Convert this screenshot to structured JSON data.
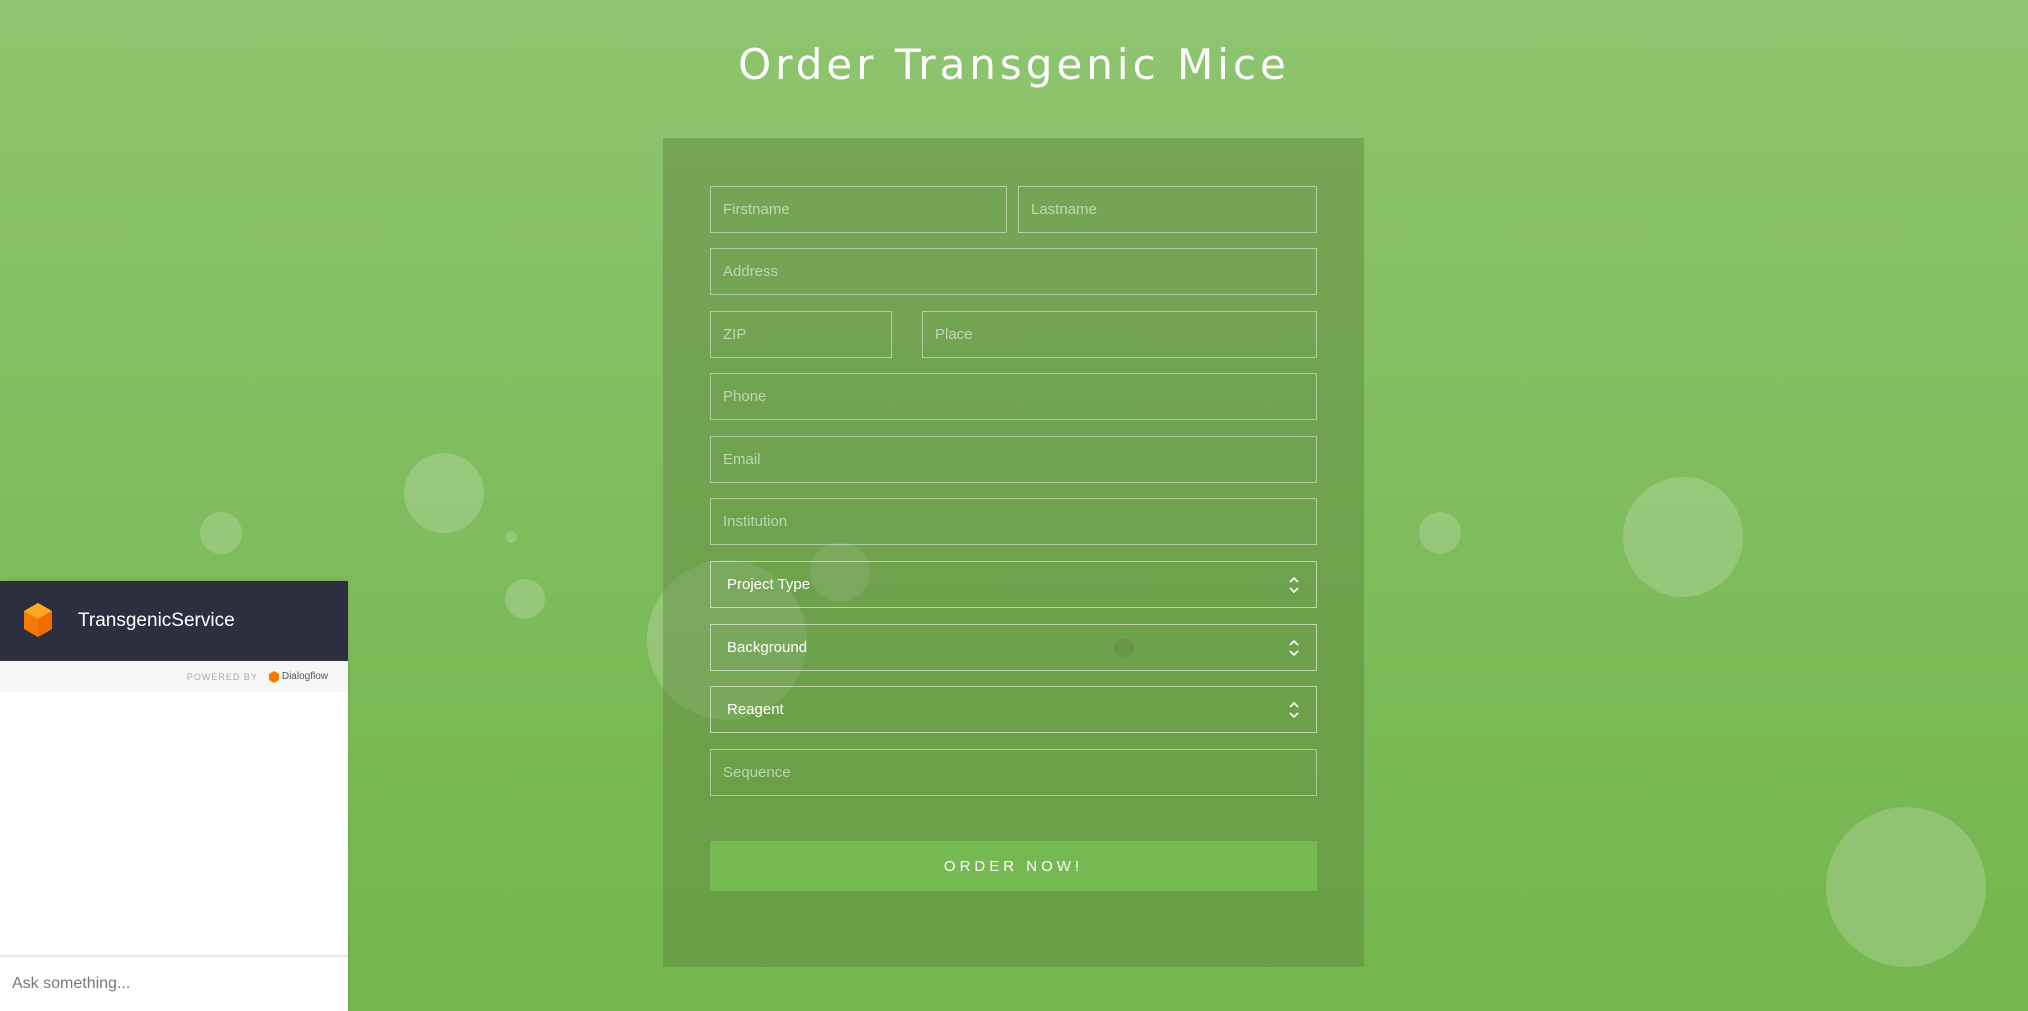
{
  "page": {
    "title": "Order Transgenic Mice"
  },
  "form": {
    "firstname_placeholder": "Firstname",
    "lastname_placeholder": "Lastname",
    "address_placeholder": "Address",
    "zip_placeholder": "ZIP",
    "place_placeholder": "Place",
    "phone_placeholder": "Phone",
    "email_placeholder": "Email",
    "institution_placeholder": "Institution",
    "project_type_label": "Project Type",
    "background_label": "Background",
    "reagent_label": "Reagent",
    "sequence_placeholder": "Sequence",
    "submit_label": "ORDER NOW!"
  },
  "chat": {
    "title": "TransgenicService",
    "powered_by": "POWERED BY",
    "provider": "Dialogflow",
    "input_placeholder": "Ask something..."
  },
  "colors": {
    "background_top": "#8ec570",
    "background_bottom": "#74b64f",
    "button": "#76b852",
    "chat_header": "#2c2f3e",
    "logo_orange": "#f57c00"
  },
  "icons": {
    "select_arrows": "chevron-up-down-icon",
    "chat_logo": "dialogflow-logo-icon"
  }
}
